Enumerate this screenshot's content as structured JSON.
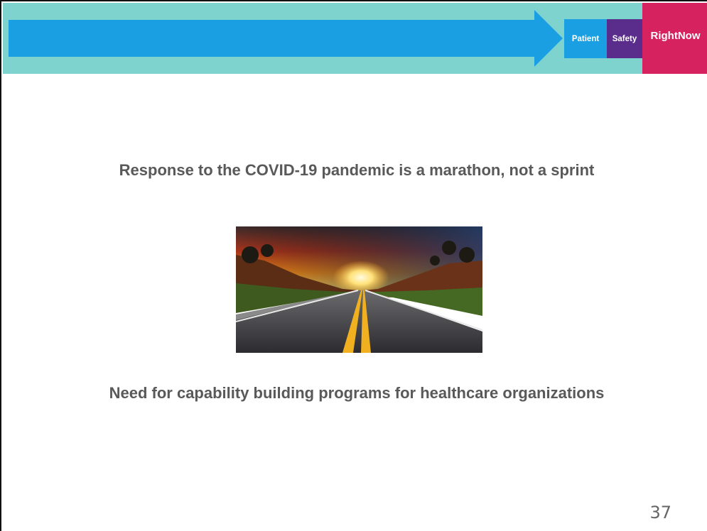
{
  "header": {
    "brand_left": "Patient",
    "brand_mid": "Safety",
    "brand_right": "RightNow",
    "colors": {
      "band": "#7fd3cf",
      "arrow": "#1aa0e2",
      "patient": "#1aa0e2",
      "safety": "#5a2d8c",
      "rightnow": "#d6225e"
    }
  },
  "slide": {
    "headline": "Response to the COVID-19 pandemic is a marathon, not a sprint",
    "subline": "Need for capability building programs for healthcare organizations",
    "page_number": "37",
    "image_icon": "road-sunset-image"
  }
}
